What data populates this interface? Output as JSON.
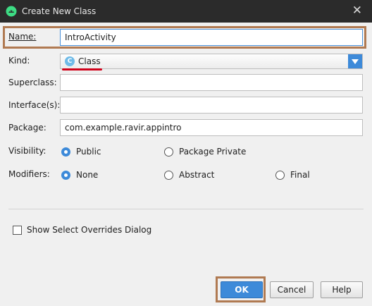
{
  "window": {
    "title": "Create New Class",
    "close_glyph": "✕"
  },
  "form": {
    "name": {
      "label": "Name:",
      "value": "IntroActivity"
    },
    "kind": {
      "label": "Kind:",
      "value": "Class",
      "icon_letter": "C"
    },
    "superclass": {
      "label": "Superclass:",
      "value": ""
    },
    "interfaces": {
      "label": "Interface(s):",
      "value": ""
    },
    "package": {
      "label": "Package:",
      "value": "com.example.ravir.appintro"
    },
    "visibility": {
      "label": "Visibility:",
      "options": [
        {
          "label": "Public",
          "selected": true
        },
        {
          "label": "Package Private",
          "selected": false
        }
      ]
    },
    "modifiers": {
      "label": "Modifiers:",
      "options": [
        {
          "label": "None",
          "selected": true
        },
        {
          "label": "Abstract",
          "selected": false
        },
        {
          "label": "Final",
          "selected": false
        }
      ]
    },
    "show_overrides": {
      "label": "Show Select Overrides Dialog",
      "checked": false
    }
  },
  "buttons": {
    "ok": "OK",
    "cancel": "Cancel",
    "help": "Help"
  },
  "colors": {
    "accent": "#3d8ad9",
    "highlight_frame": "#b07a52",
    "annotation_red": "#d0021b"
  }
}
